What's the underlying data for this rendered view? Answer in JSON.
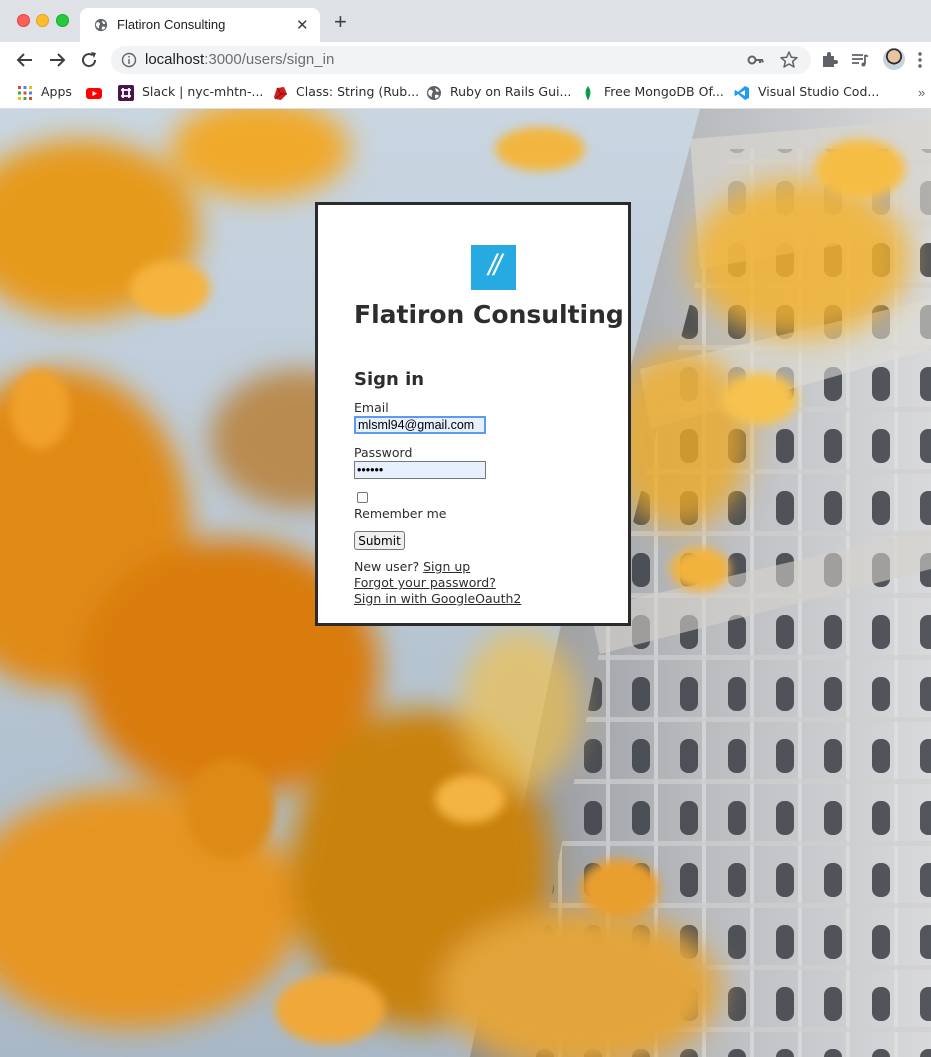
{
  "browser": {
    "tab_title": "Flatiron Consulting",
    "url_host": "localhost",
    "url_path": ":3000/users/sign_in",
    "bookmarks": [
      {
        "label": "Apps",
        "icon": "apps-grid-icon"
      },
      {
        "label": "Slack | nyc-mhtn-...",
        "icon": "slack-icon"
      },
      {
        "label": "Class: String (Rub...",
        "icon": "ruby-icon"
      },
      {
        "label": "Ruby on Rails Gui...",
        "icon": "globe-icon"
      },
      {
        "label": "Free MongoDB Of...",
        "icon": "mongodb-leaf-icon"
      },
      {
        "label": "Visual Studio Cod...",
        "icon": "vscode-icon"
      }
    ],
    "more_bookmarks": "»"
  },
  "login": {
    "logo_text": "//",
    "brand": "Flatiron Consulting",
    "heading": "Sign in",
    "email_label": "Email",
    "email_value": "mlsml94@gmail.com",
    "password_label": "Password",
    "password_value": "••••••",
    "remember_label": "Remember me",
    "remember_checked": false,
    "submit_label": "Submit",
    "new_user_text": "New user?",
    "signup_link": "Sign up",
    "forgot_link": "Forgot your password?",
    "oauth_link": "Sign in with GoogleOauth2"
  },
  "colors": {
    "logo_bg": "#27a9e1",
    "card_border": "#2b2b2b",
    "input_bg": "#e8f0fe"
  }
}
